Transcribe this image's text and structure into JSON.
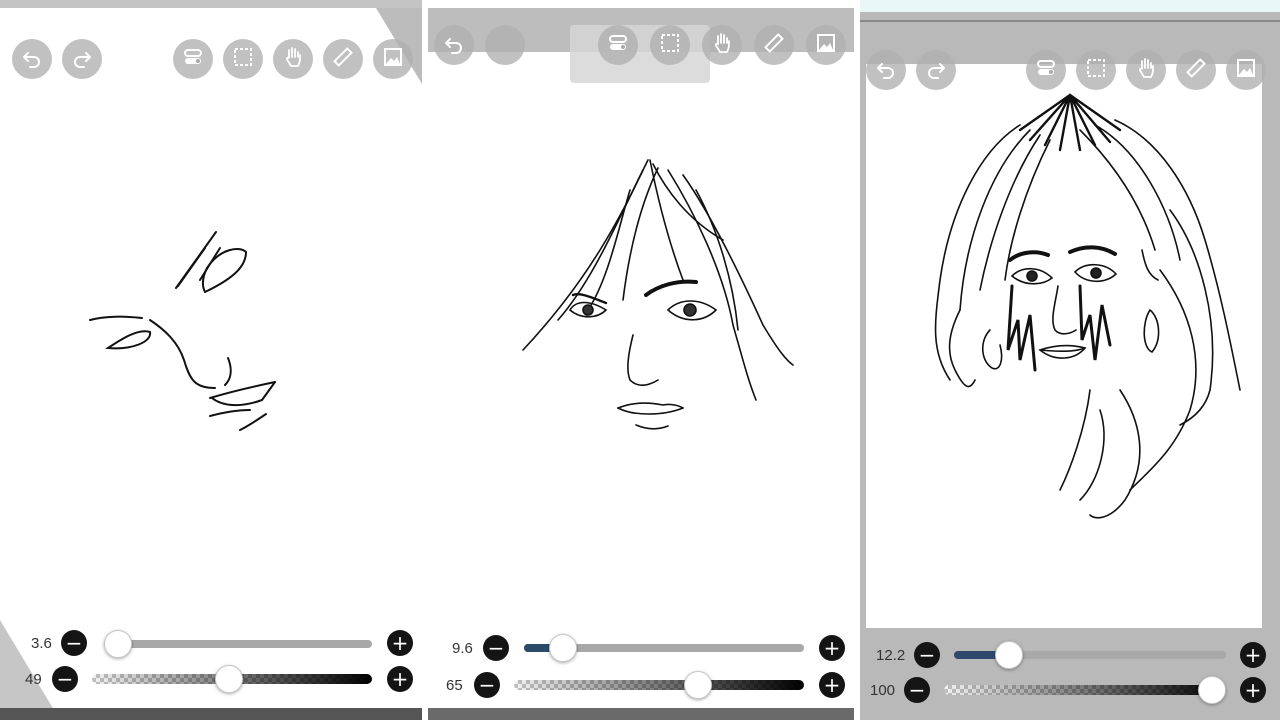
{
  "panels": [
    {
      "toolbar": {
        "left": [
          {
            "icon": "undo-icon"
          },
          {
            "icon": "redo-icon"
          }
        ],
        "right": [
          {
            "icon": "toggle-icon"
          },
          {
            "icon": "selection-icon"
          },
          {
            "icon": "hand-icon"
          },
          {
            "icon": "ruler-icon"
          },
          {
            "icon": "image-icon"
          }
        ]
      },
      "brush": {
        "size_label": "3.6",
        "size_fraction": 0.0,
        "opacity_label": "49",
        "opacity_fraction": 0.49
      }
    },
    {
      "toolbar": {
        "left": [
          {
            "icon": "undo-icon"
          },
          {
            "icon": "redo-icon"
          }
        ],
        "right": [
          {
            "icon": "toggle-icon"
          },
          {
            "icon": "selection-icon"
          },
          {
            "icon": "hand-icon"
          },
          {
            "icon": "ruler-icon"
          },
          {
            "icon": "image-icon"
          }
        ]
      },
      "brush": {
        "size_label": "9.6",
        "size_fraction": 0.1,
        "opacity_label": "65",
        "opacity_fraction": 0.65
      }
    },
    {
      "toolbar": {
        "left": [
          {
            "icon": "undo-icon"
          },
          {
            "icon": "redo-icon"
          }
        ],
        "right": [
          {
            "icon": "toggle-icon"
          },
          {
            "icon": "selection-icon"
          },
          {
            "icon": "hand-icon"
          },
          {
            "icon": "ruler-icon"
          },
          {
            "icon": "image-icon"
          }
        ]
      },
      "brush": {
        "size_label": "12.2",
        "size_fraction": 0.17,
        "opacity_label": "100",
        "opacity_fraction": 1.0
      }
    }
  ],
  "controls": {
    "minus": "−",
    "plus": "+"
  },
  "colors": {
    "slider_fill": "#2d4a6d",
    "button_bg": "#141414",
    "toolbar_button": "#afafaf",
    "frame": "#b9b9b9"
  }
}
